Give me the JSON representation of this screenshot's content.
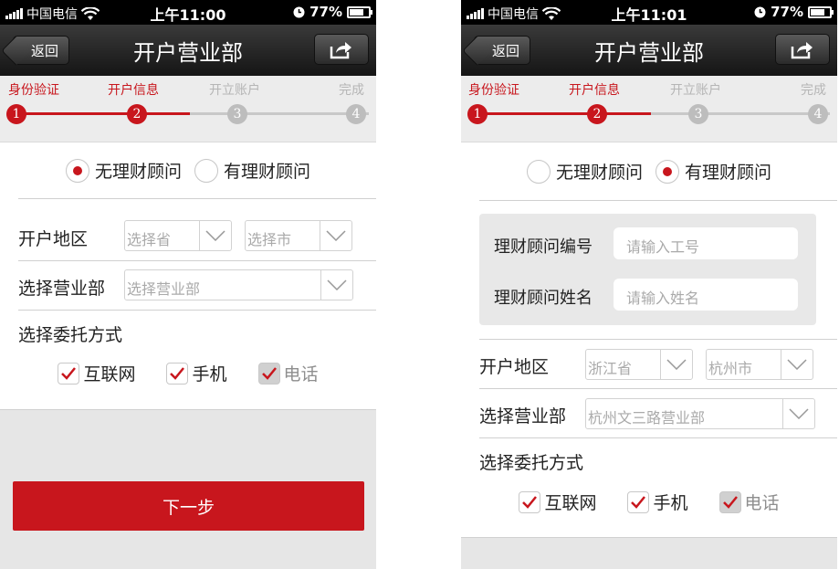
{
  "left_screen": {
    "status": {
      "carrier": "中国电信",
      "time": "上午11:00",
      "battery": "77%",
      "battery_level": 0.77
    },
    "nav": {
      "back": "返回",
      "title": "开户营业部"
    },
    "steps": [
      "身份验证",
      "开户信息",
      "开立账户",
      "完成"
    ],
    "step_numbers": [
      "1",
      "2",
      "3",
      "4"
    ],
    "current_step": 2,
    "advisor_options": [
      "无理财顾问",
      "有理财顾问"
    ],
    "advisor_selected": 0,
    "region_label": "开户地区",
    "province": "选择省",
    "city": "选择市",
    "branch_label": "选择营业部",
    "branch": "选择营业部",
    "method_label": "选择委托方式",
    "methods": [
      "互联网",
      "手机",
      "电话"
    ],
    "next_button": "下一步"
  },
  "right_screen": {
    "status": {
      "carrier": "中国电信",
      "time": "上午11:01",
      "battery": "77%",
      "battery_level": 0.77
    },
    "nav": {
      "back": "返回",
      "title": "开户营业部"
    },
    "steps": [
      "身份验证",
      "开户信息",
      "开立账户",
      "完成"
    ],
    "step_numbers": [
      "1",
      "2",
      "3",
      "4"
    ],
    "current_step": 2,
    "advisor_options": [
      "无理财顾问",
      "有理财顾问"
    ],
    "advisor_selected": 1,
    "advisor_id_label": "理财顾问编号",
    "advisor_id_placeholder": "请输入工号",
    "advisor_name_label": "理财顾问姓名",
    "advisor_name_placeholder": "请输入姓名",
    "region_label": "开户地区",
    "province": "浙江省",
    "city": "杭州市",
    "branch_label": "选择营业部",
    "branch": "杭州文三路营业部",
    "method_label": "选择委托方式",
    "methods": [
      "互联网",
      "手机",
      "电话"
    ]
  },
  "colors": {
    "accent": "#c8161d",
    "inactive": "#bdbdbd",
    "navbar": "#151515"
  },
  "icons": {
    "share": "share-icon",
    "check": "check-icon",
    "chevron": "chevron-down-icon",
    "wifi": "wifi-icon",
    "clock": "clock-icon",
    "battery": "battery-icon"
  }
}
